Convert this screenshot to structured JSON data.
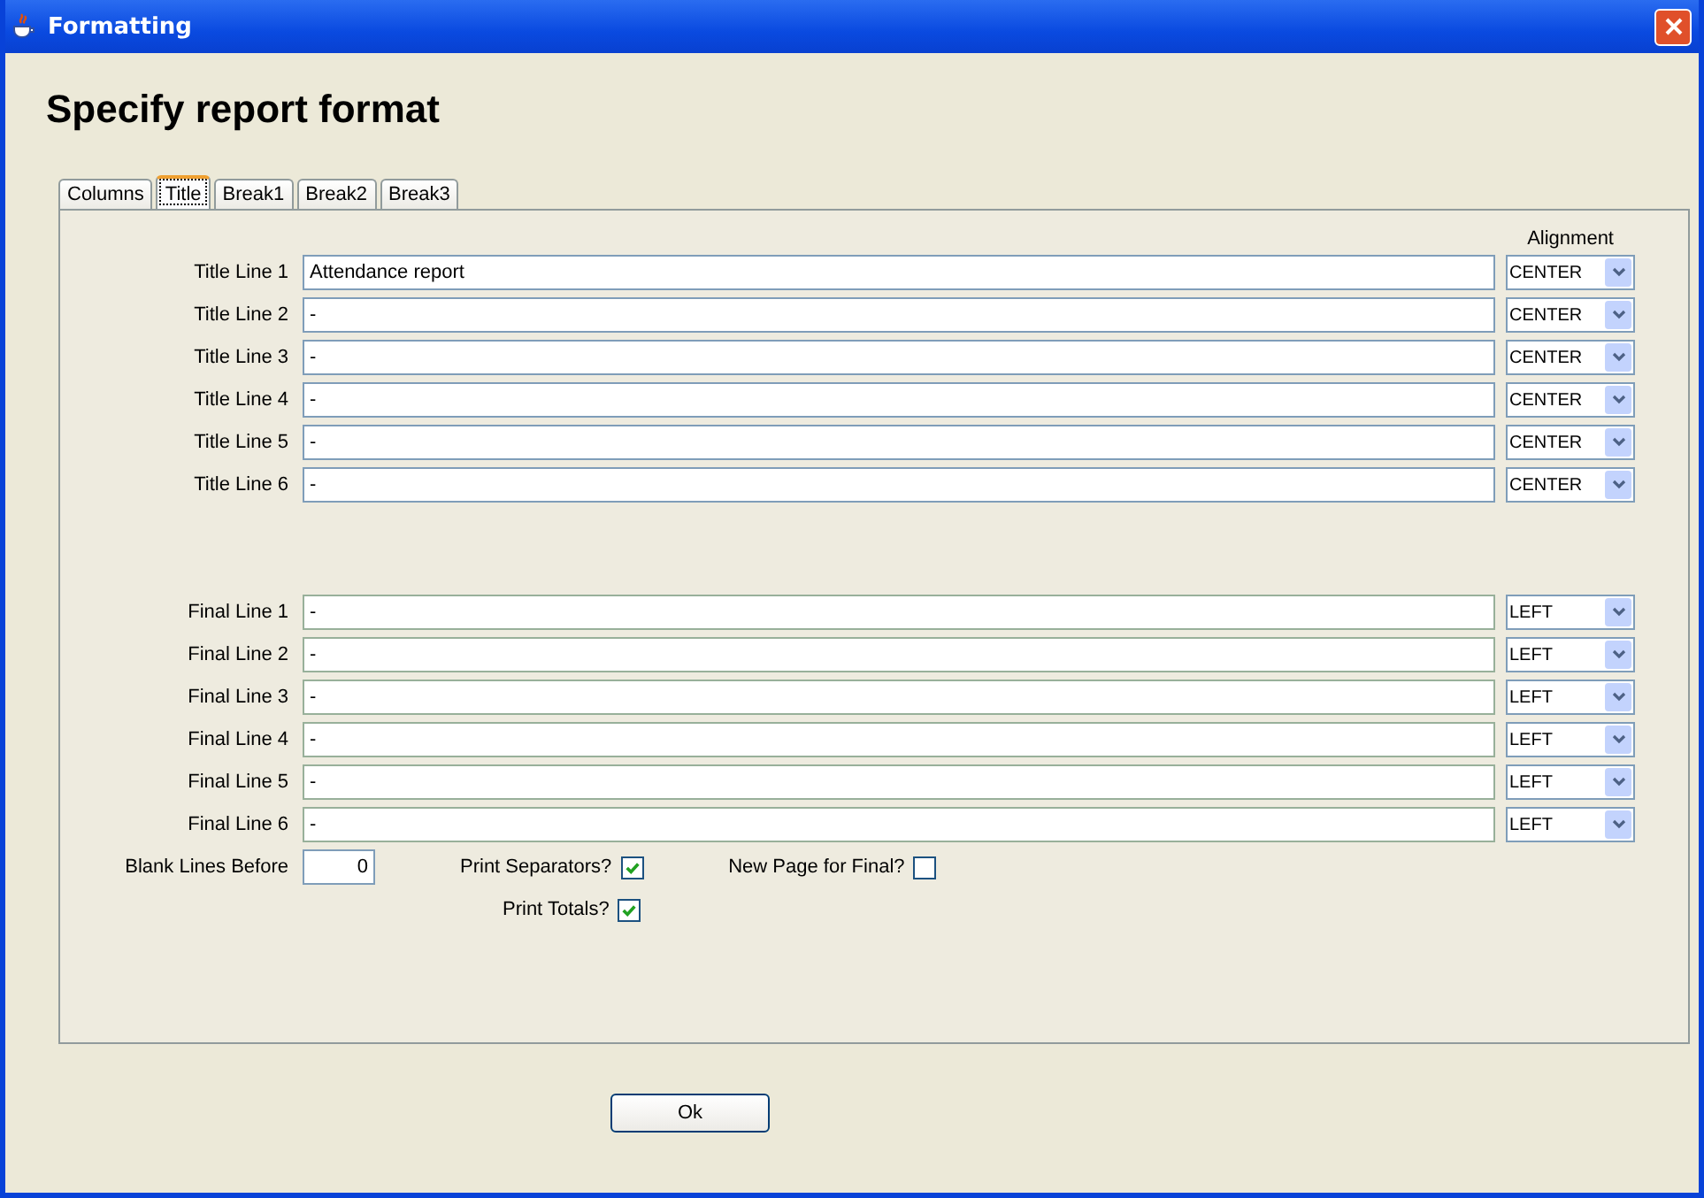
{
  "window": {
    "title": "Formatting"
  },
  "heading": "Specify report format",
  "tabs": [
    {
      "label": "Columns",
      "selected": false
    },
    {
      "label": "Title",
      "selected": true
    },
    {
      "label": "Break1",
      "selected": false
    },
    {
      "label": "Break2",
      "selected": false
    },
    {
      "label": "Break3",
      "selected": false
    }
  ],
  "alignment_header": "Alignment",
  "title_lines": [
    {
      "label": "Title Line 1",
      "value": "Attendance report",
      "alignment": "CENTER"
    },
    {
      "label": "Title Line 2",
      "value": "-",
      "alignment": "CENTER"
    },
    {
      "label": "Title Line 3",
      "value": "-",
      "alignment": "CENTER"
    },
    {
      "label": "Title Line 4",
      "value": "-",
      "alignment": "CENTER"
    },
    {
      "label": "Title Line 5",
      "value": "-",
      "alignment": "CENTER"
    },
    {
      "label": "Title Line 6",
      "value": "-",
      "alignment": "CENTER"
    }
  ],
  "final_lines": [
    {
      "label": "Final Line 1",
      "value": "-",
      "alignment": "LEFT"
    },
    {
      "label": "Final Line 2",
      "value": "-",
      "alignment": "LEFT"
    },
    {
      "label": "Final Line 3",
      "value": "-",
      "alignment": "LEFT"
    },
    {
      "label": "Final Line 4",
      "value": "-",
      "alignment": "LEFT"
    },
    {
      "label": "Final Line 5",
      "value": "-",
      "alignment": "LEFT"
    },
    {
      "label": "Final Line 6",
      "value": "-",
      "alignment": "LEFT"
    }
  ],
  "blank_lines_before": {
    "label": "Blank Lines Before",
    "value": "0"
  },
  "print_separators": {
    "label": "Print Separators?",
    "checked": true
  },
  "new_page_for_final": {
    "label": "New Page for Final?",
    "checked": false
  },
  "print_totals": {
    "label": "Print Totals?",
    "checked": true
  },
  "ok_button": "Ok"
}
